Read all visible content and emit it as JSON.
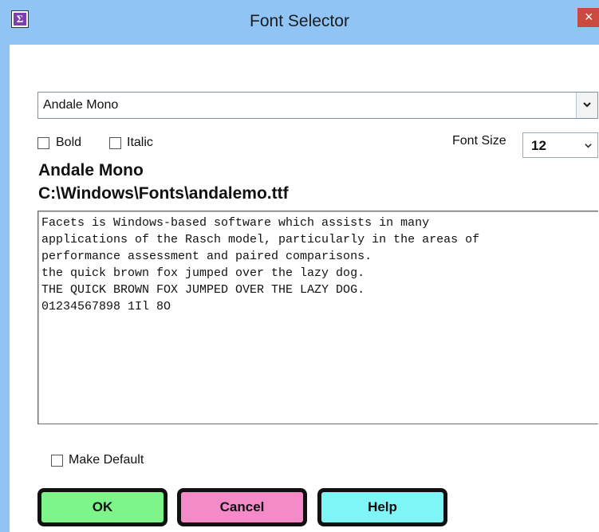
{
  "window": {
    "title": "Font Selector",
    "icon_glyph": "Σ",
    "close_glyph": "×"
  },
  "font_select": {
    "value": "Andale Mono"
  },
  "options": {
    "bold_label": "Bold",
    "bold_checked": false,
    "italic_label": "Italic",
    "italic_checked": false,
    "font_size_label": "Font Size",
    "font_size_value": "12"
  },
  "info": {
    "font_name": "Andale Mono",
    "font_path": "C:\\Windows\\Fonts\\andalemo.ttf"
  },
  "preview": {
    "lines": [
      "Facets is Windows-based software which assists in many",
      "applications of the Rasch model, particularly in the areas of",
      "performance assessment and paired comparisons.",
      "the quick brown fox jumped over the lazy dog.",
      "THE QUICK BROWN FOX JUMPED OVER THE LAZY DOG.",
      "01234567898 1Il 8O"
    ]
  },
  "make_default": {
    "label": "Make Default",
    "checked": false
  },
  "buttons": {
    "ok": {
      "label": "OK",
      "color": "#7ef58a"
    },
    "cancel": {
      "label": "Cancel",
      "color": "#f58ac8"
    },
    "help": {
      "label": "Help",
      "color": "#7ef6f8"
    }
  },
  "colors": {
    "titlebar": "#8fc4f4",
    "close": "#c94b3f"
  }
}
